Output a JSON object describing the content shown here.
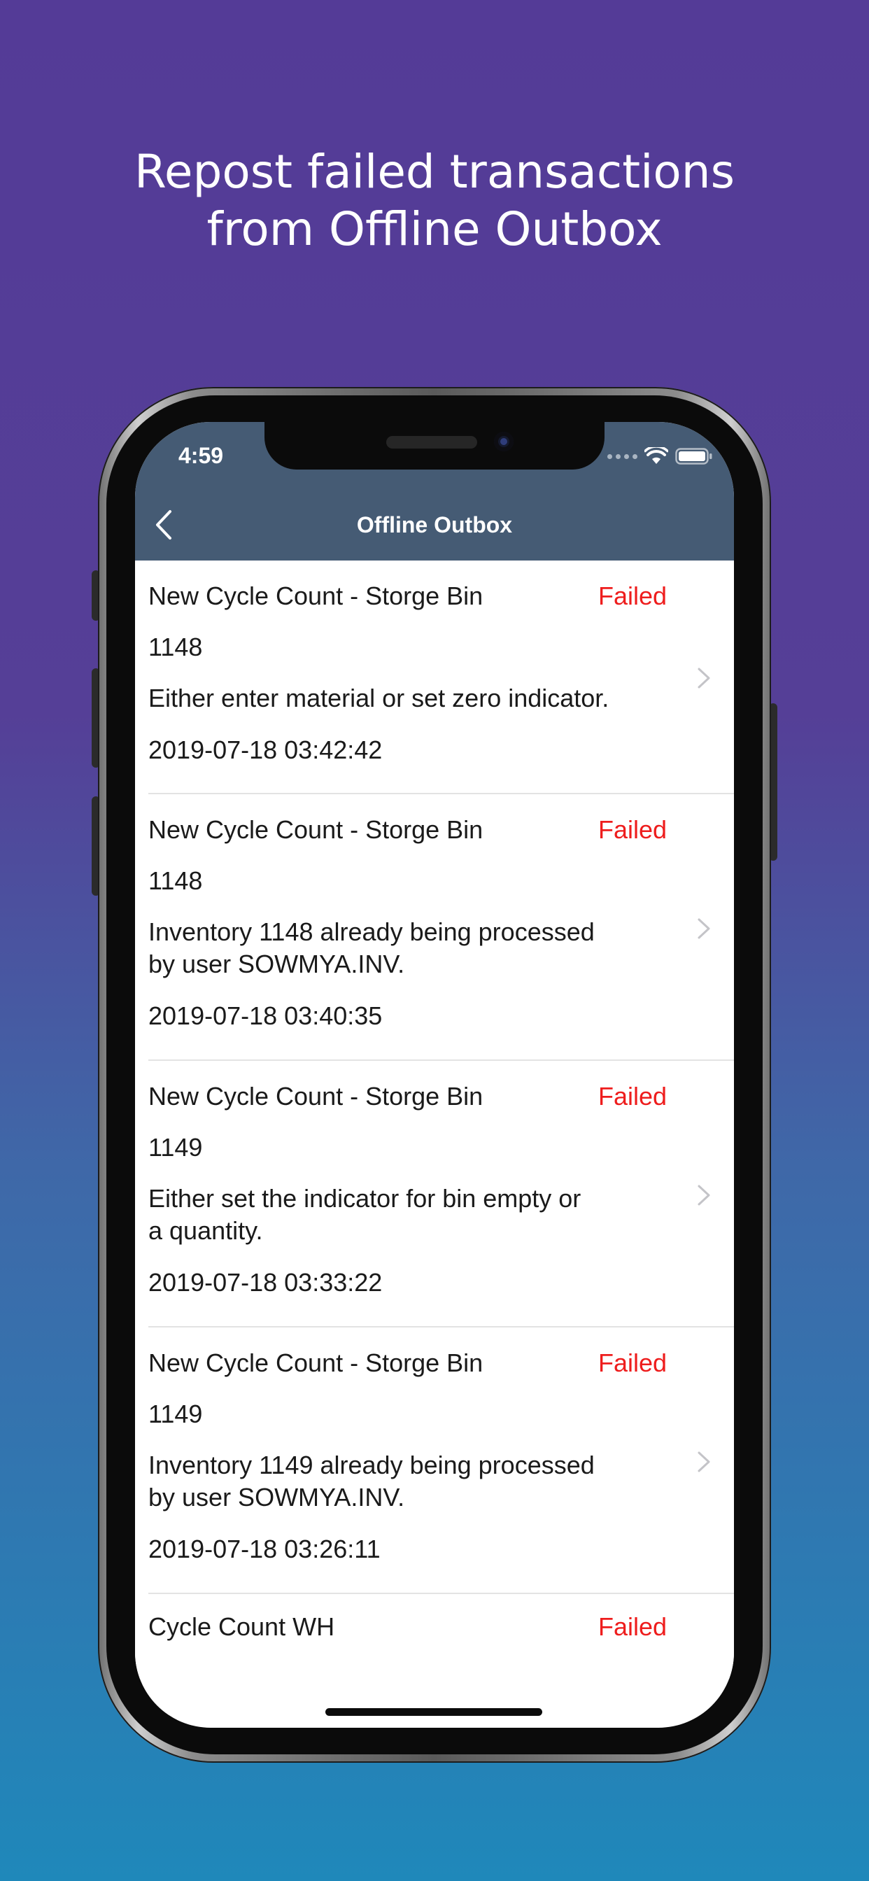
{
  "headline": {
    "line1": "Repost failed transactions",
    "line2": "from Offline Outbox"
  },
  "status_bar": {
    "time": "4:59"
  },
  "nav": {
    "title": "Offline Outbox"
  },
  "items": [
    {
      "title": "New Cycle Count - Storge Bin",
      "status": "Failed",
      "number": "1148",
      "message_lines": [
        "Either enter material or set zero indicator."
      ],
      "timestamp": "2019-07-18 03:42:42"
    },
    {
      "title": "New Cycle Count - Storge Bin",
      "status": "Failed",
      "number": "1148",
      "message_lines": [
        "Inventory 1148 already being processed",
        "by user SOWMYA.INV."
      ],
      "timestamp": "2019-07-18 03:40:35"
    },
    {
      "title": "New Cycle Count - Storge Bin",
      "status": "Failed",
      "number": "1149",
      "message_lines": [
        "Either set the indicator for bin empty or",
        "a quantity."
      ],
      "timestamp": "2019-07-18 03:33:22"
    },
    {
      "title": "New Cycle Count - Storge Bin",
      "status": "Failed",
      "number": "1149",
      "message_lines": [
        "Inventory 1149 already being processed",
        "by user SOWMYA.INV."
      ],
      "timestamp": "2019-07-18 03:26:11"
    },
    {
      "title": "Cycle Count WH",
      "status": "Failed"
    }
  ],
  "colors": {
    "nav_bar": "#455b74",
    "status_failed": "#ee1d1d",
    "background_top": "#543b97",
    "background_bottom": "#1f88ba"
  },
  "icons": {
    "back": "chevron-left-icon",
    "row_disclosure": "chevron-right-icon",
    "wifi": "wifi-icon",
    "battery": "battery-icon",
    "signal": "cellular-signal-icon"
  }
}
